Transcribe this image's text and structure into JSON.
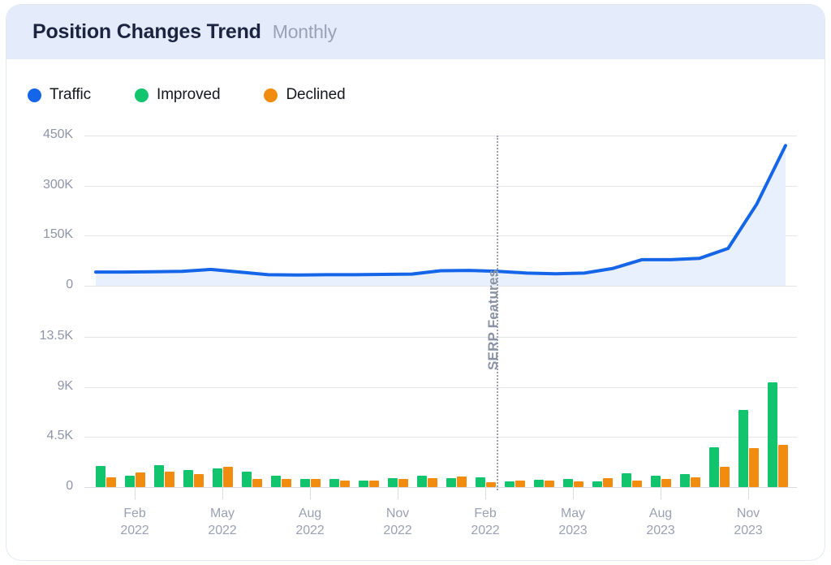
{
  "header": {
    "title": "Position Changes Trend",
    "subtitle": "Monthly"
  },
  "legend": [
    {
      "label": "Traffic",
      "color": "#1565e8",
      "icon": "legend-dot-icon"
    },
    {
      "label": "Improved",
      "color": "#12c46e",
      "icon": "legend-dot-icon"
    },
    {
      "label": "Declined",
      "color": "#f28c0f",
      "icon": "legend-dot-icon"
    }
  ],
  "annotation": {
    "label": "SERP Features",
    "at_month": "2023-02",
    "color": "#8a91a3"
  },
  "chart_data": {
    "type": "line",
    "title": "Position Changes Trend",
    "subtitle": "Monthly",
    "xlabel": "",
    "grid": true,
    "legend_position": "top-left",
    "annotations": [
      {
        "text": "SERP Features",
        "type": "vertical-reference-line",
        "x": "2023-02"
      }
    ],
    "x": [
      "2022-01",
      "2022-02",
      "2022-03",
      "2022-04",
      "2022-05",
      "2022-06",
      "2022-07",
      "2022-08",
      "2022-09",
      "2022-10",
      "2022-11",
      "2022-12",
      "2023-01",
      "2023-02",
      "2023-03",
      "2023-04",
      "2023-05",
      "2023-06",
      "2023-07",
      "2023-08",
      "2023-09",
      "2023-10",
      "2023-11",
      "2023-12"
    ],
    "xtick_labels": [
      {
        "month": "Feb",
        "year": "2022"
      },
      {
        "month": "May",
        "year": "2022"
      },
      {
        "month": "Aug",
        "year": "2022"
      },
      {
        "month": "Nov",
        "year": "2022"
      },
      {
        "month": "Feb",
        "year": "2022"
      },
      {
        "month": "May",
        "year": "2023"
      },
      {
        "month": "Aug",
        "year": "2023"
      },
      {
        "month": "Nov",
        "year": "2023"
      }
    ],
    "panels": [
      {
        "name": "traffic",
        "type": "area",
        "ylabel": "",
        "ylim": [
          0,
          450000
        ],
        "yticks": [
          0,
          150000,
          300000,
          450000
        ],
        "ytick_labels": [
          "0",
          "150K",
          "300K",
          "450K"
        ],
        "series": [
          {
            "name": "Traffic",
            "color": "#1565e8",
            "fill": "#e8f0fd",
            "values": [
              41000,
              41000,
              42000,
              43000,
              49000,
              41000,
              33000,
              32000,
              33000,
              33000,
              34000,
              35000,
              45000,
              46000,
              43000,
              38000,
              36000,
              38000,
              52000,
              78000,
              78000,
              82000,
              112000,
              245000
            ],
            "last_value": 420000
          }
        ]
      },
      {
        "name": "position-changes",
        "type": "bar",
        "ylabel": "",
        "ylim": [
          0,
          13500
        ],
        "yticks": [
          0,
          4500,
          9000,
          13500
        ],
        "ytick_labels": [
          "0",
          "4.5K",
          "9K",
          "13.5K"
        ],
        "series": [
          {
            "name": "Improved",
            "color": "#12c46e",
            "values": [
              1900,
              1050,
              2000,
              1500,
              1650,
              1400,
              1000,
              700,
              750,
              620,
              800,
              1000,
              780,
              900,
              500,
              650,
              720,
              520,
              1250,
              1050,
              1150,
              3600,
              6900,
              9400
            ]
          },
          {
            "name": "Declined",
            "color": "#f28c0f",
            "values": [
              880,
              1300,
              1400,
              1150,
              1800,
              750,
              720,
              700,
              620,
              560,
              700,
              800,
              930,
              450,
              620,
              600,
              520,
              780,
              620,
              700,
              900,
              1800,
              3500,
              3800
            ]
          }
        ]
      }
    ]
  }
}
